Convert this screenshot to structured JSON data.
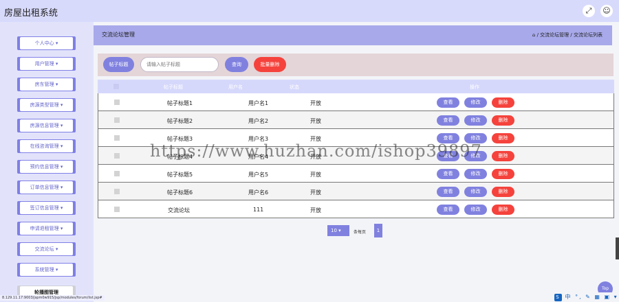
{
  "app": {
    "title": "房屋出租系统"
  },
  "header": {
    "icons": [
      "fullscreen-icon",
      "user-icon"
    ]
  },
  "sidebar": {
    "items": [
      {
        "label": "个人中心 ▾"
      },
      {
        "label": "用户管理 ▾"
      },
      {
        "label": "房东管理 ▾"
      },
      {
        "label": "房源类型管理 ▾"
      },
      {
        "label": "房源信息管理 ▾"
      },
      {
        "label": "在线咨询管理 ▾"
      },
      {
        "label": "预约信息管理 ▾"
      },
      {
        "label": "订单信息管理 ▾"
      },
      {
        "label": "签订信息管理 ▾"
      },
      {
        "label": "申请退租管理 ▾"
      },
      {
        "label": "交流论坛 ▾"
      },
      {
        "label": "系统管理 ▾"
      },
      {
        "label": "轮播图管理"
      }
    ]
  },
  "page": {
    "title": "交流论坛管理",
    "breadcrumb": "/ 交流论坛管理 / 交流论坛列表"
  },
  "search": {
    "label": "帖子标题",
    "placeholder": "请输入帖子标题",
    "query_button": "查询",
    "batch_delete_button": "批量删除"
  },
  "table": {
    "columns": [
      "帖子标题",
      "用户名",
      "状态",
      "操作"
    ],
    "actions": {
      "view": "查看",
      "edit": "修改",
      "delete": "删除"
    },
    "rows": [
      {
        "title": "帖子标题1",
        "user": "用户名1",
        "status": "开放"
      },
      {
        "title": "帖子标题2",
        "user": "用户名2",
        "status": "开放"
      },
      {
        "title": "帖子标题3",
        "user": "用户名3",
        "status": "开放"
      },
      {
        "title": "帖子标题4",
        "user": "用户名4",
        "status": "开放"
      },
      {
        "title": "帖子标题5",
        "user": "用户名5",
        "status": "开放"
      },
      {
        "title": "帖子标题6",
        "user": "用户名6",
        "status": "开放"
      },
      {
        "title": "交流论坛",
        "user": "111",
        "status": "开放"
      }
    ]
  },
  "pagination": {
    "page_size": "10 ▾",
    "text": "条每页",
    "current_page": "1"
  },
  "watermark": "https://www.huzhan.com/ishop39897",
  "status_url": "8.129.11.17:9003/jspm0w915/jsp/modules/forum/list.jsp#",
  "back_to_top": "Top",
  "tray": "中 °, ✎ ▦ ▣ ▾ ▦"
}
